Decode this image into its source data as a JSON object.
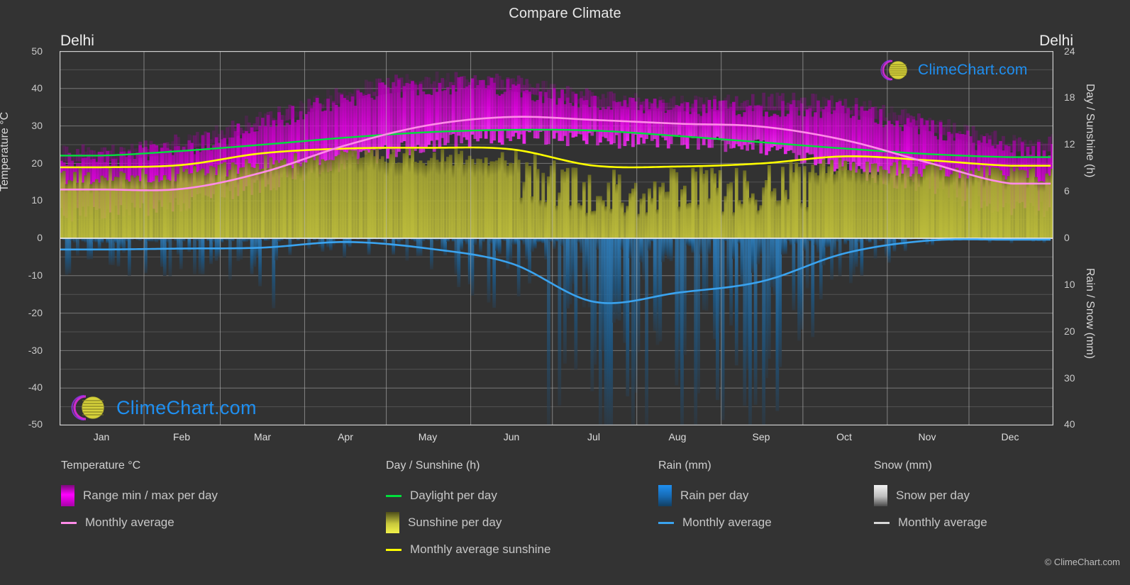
{
  "header": {
    "title": "Compare Climate",
    "location_left": "Delhi",
    "location_right": "Delhi"
  },
  "axes": {
    "left_title": "Temperature °C",
    "right_top_title": "Day / Sunshine (h)",
    "right_bottom_title": "Rain / Snow (mm)",
    "left_ticks": [
      "50",
      "40",
      "30",
      "20",
      "10",
      "0",
      "-10",
      "-20",
      "-30",
      "-40",
      "-50"
    ],
    "right_top_ticks": [
      "24",
      "18",
      "12",
      "6",
      "0"
    ],
    "right_bottom_ticks": [
      "0",
      "10",
      "20",
      "30",
      "40"
    ],
    "x_ticks": [
      "Jan",
      "Feb",
      "Mar",
      "Apr",
      "May",
      "Jun",
      "Jul",
      "Aug",
      "Sep",
      "Oct",
      "Nov",
      "Dec"
    ]
  },
  "legend": {
    "groups": [
      {
        "title": "Temperature °C",
        "items": [
          {
            "label": "Range min / max per day",
            "marker": "gradient-box",
            "color": "#ff00ff"
          },
          {
            "label": "Monthly average",
            "marker": "line",
            "color": "#ff8ce8"
          }
        ]
      },
      {
        "title": "Day / Sunshine (h)",
        "items": [
          {
            "label": "Daylight per day",
            "marker": "line",
            "color": "#00e03c"
          },
          {
            "label": "Sunshine per day",
            "marker": "gradient-box",
            "color": "#f2f24a"
          },
          {
            "label": "Monthly average sunshine",
            "marker": "line",
            "color": "#ffff00"
          }
        ]
      },
      {
        "title": "Rain (mm)",
        "items": [
          {
            "label": "Rain per day",
            "marker": "gradient-box",
            "color": "#1f8ff0"
          },
          {
            "label": "Monthly average",
            "marker": "line",
            "color": "#3aa3ef"
          }
        ]
      },
      {
        "title": "Snow (mm)",
        "items": [
          {
            "label": "Snow per day",
            "marker": "gradient-box",
            "color": "#e8e8e8"
          },
          {
            "label": "Monthly average",
            "marker": "line",
            "color": "#d8d8d8"
          }
        ]
      }
    ]
  },
  "branding": {
    "logo_text": "ClimeChart.com",
    "copyright": "© ClimeChart.com"
  },
  "colors": {
    "background": "#333333",
    "plot_background": "#323232",
    "grid": "#9a9a9a",
    "temp_range": "#d400d4",
    "temp_avg": "#ff8ce8",
    "daylight": "#00e03c",
    "sunshine_fill": "#b2b234",
    "sunshine_avg": "#ffff00",
    "rain_fill": "#1d6fae",
    "rain_avg": "#3aa3ef",
    "text": "#d8d8d8",
    "link": "#1f8ff0"
  },
  "chart_data": {
    "type": "area",
    "title": "Compare Climate",
    "subtitle": "Delhi",
    "xlabel": "",
    "ylabel": "Temperature °C",
    "ylim": [
      -50,
      50
    ],
    "y2lim_top": [
      0,
      24
    ],
    "y2lim_bottom": [
      0,
      40
    ],
    "grid": true,
    "legend_position": "bottom",
    "categories": [
      "Jan",
      "Feb",
      "Mar",
      "Apr",
      "May",
      "Jun",
      "Jul",
      "Aug",
      "Sep",
      "Oct",
      "Nov",
      "Dec"
    ],
    "series": [
      {
        "name": "Monthly average temperature (°C)",
        "unit": "°C",
        "color": "#ff8ce8",
        "values": [
          13.0,
          13.2,
          17.6,
          24.8,
          30.2,
          32.4,
          31.6,
          30.6,
          29.8,
          26.2,
          20.2,
          14.6
        ]
      },
      {
        "name": "Daily maximum temperature (°C)",
        "unit": "°C",
        "color": "#d400d4",
        "values": [
          20.5,
          23.5,
          29.5,
          36.5,
          39.8,
          39.2,
          35.2,
          33.8,
          34.2,
          33.2,
          28.5,
          23.2
        ]
      },
      {
        "name": "Daily minimum temperature (°C)",
        "unit": "°C",
        "color": "#d400d4",
        "values": [
          7.2,
          9.8,
          14.5,
          20.8,
          25.6,
          27.8,
          26.8,
          26.2,
          24.8,
          19.5,
          13.2,
          8.4
        ]
      },
      {
        "name": "Daylight per day (h)",
        "unit": "h",
        "color": "#00e03c",
        "values": [
          10.6,
          11.2,
          12.0,
          12.9,
          13.6,
          13.9,
          13.8,
          13.1,
          12.3,
          11.5,
          10.8,
          10.4
        ]
      },
      {
        "name": "Monthly average sunshine (h)",
        "unit": "h",
        "color": "#ffff00",
        "values": [
          9.1,
          9.4,
          10.9,
          11.5,
          11.6,
          11.4,
          9.3,
          9.2,
          9.6,
          10.5,
          10.0,
          9.3
        ]
      },
      {
        "name": "Monthly average rain (mm)",
        "unit": "mm",
        "color": "#3aa3ef",
        "values": [
          2.4,
          2.2,
          2.0,
          0.8,
          2.2,
          5.4,
          13.6,
          11.6,
          9.2,
          3.2,
          0.5,
          0.3
        ]
      },
      {
        "name": "Monthly average snow (mm)",
        "unit": "mm",
        "color": "#d8d8d8",
        "values": [
          0,
          0,
          0,
          0,
          0,
          0,
          0,
          0,
          0,
          0,
          0,
          0
        ]
      }
    ],
    "annotations": [
      "Daily range band shown in magenta (min/max per day)",
      "Sunshine hours shown as olive-yellow daily bars",
      "Daily rain shown as blue bars below zero axis"
    ]
  }
}
